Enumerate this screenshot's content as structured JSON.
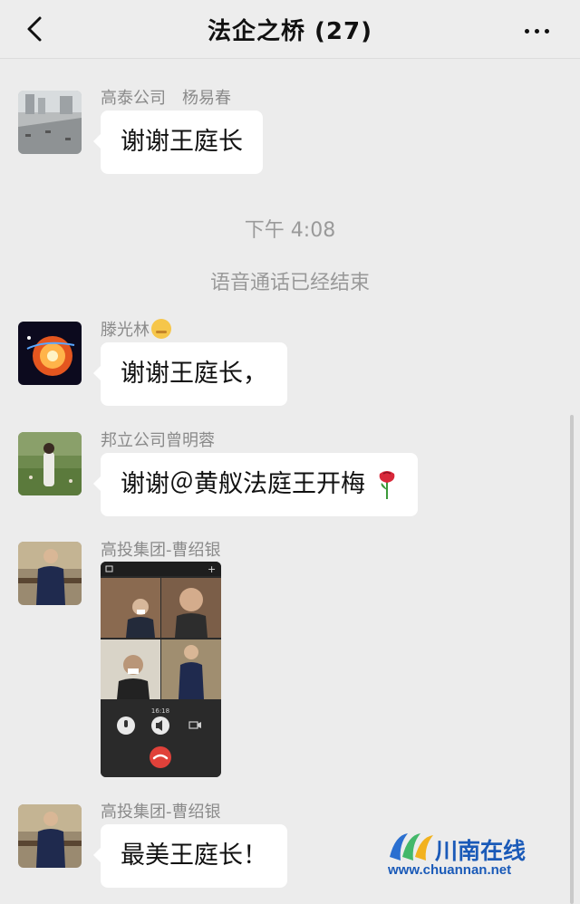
{
  "header": {
    "title": "法企之桥 (27)"
  },
  "messages": [
    {
      "sender": "高泰公司　杨易春",
      "text": "谢谢王庭长"
    },
    {
      "sender": "滕光林",
      "text": "谢谢王庭长，"
    },
    {
      "sender": "邦立公司曾明蓉",
      "text": "谢谢＠黄舣法庭王开梅"
    },
    {
      "sender": "高投集团-曹绍银"
    },
    {
      "sender": "高投集团-曹绍银",
      "text": "最美王庭长！"
    }
  ],
  "system": {
    "time": "下午 4:08",
    "notice": "语音通话已经结束"
  },
  "call_screenshot": {
    "time": "16:18"
  },
  "watermark": {
    "brand": "川南在线",
    "url": "www.chuannan.net"
  }
}
